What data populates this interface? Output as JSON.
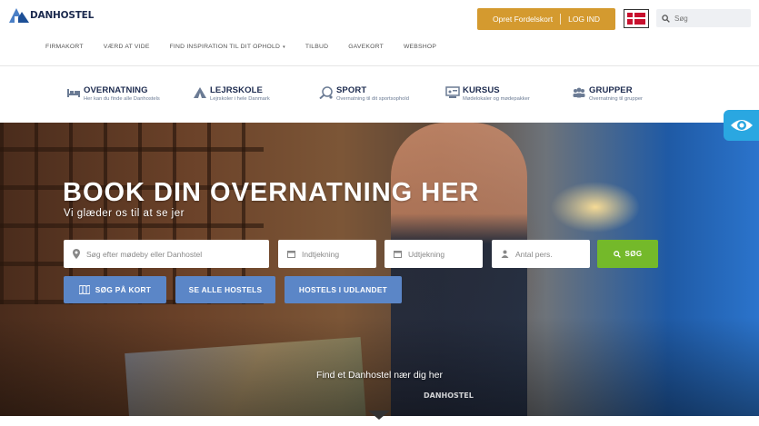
{
  "header": {
    "logo_text": "DANHOSTEL",
    "member_label": "Opret Fordelskort",
    "login_label": "LOG IND",
    "language_flag": "denmark-flag-icon",
    "search_placeholder": "Søg"
  },
  "main_nav": [
    {
      "label": "FIRMAKORT"
    },
    {
      "label": "VÆRD AT VIDE"
    },
    {
      "label": "FIND INSPIRATION TIL DIT OPHOLD",
      "caret": "▾"
    },
    {
      "label": "TILBUD"
    },
    {
      "label": "GAVEKORT"
    },
    {
      "label": "WEBSHOP"
    }
  ],
  "categories": [
    {
      "title": "OVERNATNING",
      "subtitle": "Her kan du finde alle Danhostels",
      "icon": "bed-icon"
    },
    {
      "title": "LEJRSKOLE",
      "subtitle": "Lejrskoler i hele Danmark",
      "icon": "tent-icon"
    },
    {
      "title": "SPORT",
      "subtitle": "Overnatning til dit sportsophold",
      "icon": "sport-icon"
    },
    {
      "title": "KURSUS",
      "subtitle": "Mødelokaler og mødepakker",
      "icon": "presentation-icon"
    },
    {
      "title": "GRUPPER",
      "subtitle": "Overnatning til grupper",
      "icon": "group-icon"
    }
  ],
  "hero": {
    "headline": "BOOK DIN OVERNATNING HER",
    "subline": "Vi glæder os til at se jer",
    "search_placeholder": "Søg efter mødeby eller Danhostel",
    "checkin_placeholder": "Indtjekning",
    "checkout_placeholder": "Udtjekning",
    "persons_placeholder": "Antal pers.",
    "search_button": "SØG",
    "map_button": "SØG PÅ KORT",
    "all_hostels_button": "SE ALLE HOSTELS",
    "abroad_button": "HOSTELS I UDLANDET",
    "find_text": "Find et Danhostel nær dig her",
    "watermark": "DANHOSTEL"
  },
  "colors": {
    "accent_gold": "#d49a2f",
    "navy": "#1d2b4f",
    "green": "#74b92a",
    "blue_button": "#5b86c7",
    "accessibility_tab": "#2aa7e1"
  }
}
